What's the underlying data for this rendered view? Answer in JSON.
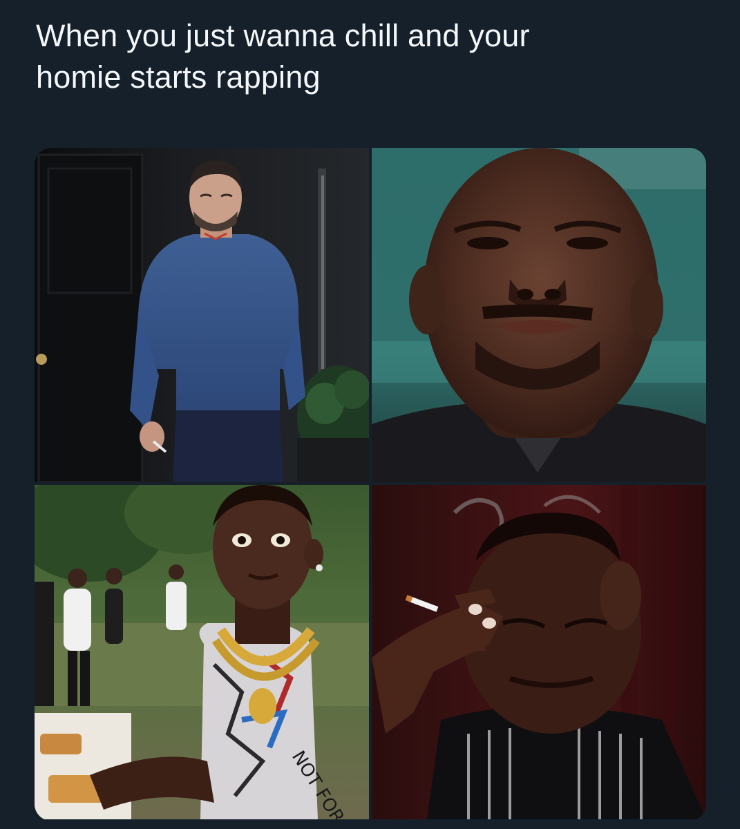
{
  "tweet": {
    "text_line_1": "When you just wanna chill and your",
    "text_line_2": "homie starts rapping"
  },
  "media": {
    "panels": [
      {
        "icon": "man-in-blue-sweater-smoking-photo"
      },
      {
        "icon": "man-looking-up-closeup-photo"
      },
      {
        "icon": "man-with-gold-chain-staring-photo",
        "shirt_text": "NOT FOR SALE"
      },
      {
        "icon": "man-holding-head-with-cigarette-photo"
      }
    ]
  },
  "colors": {
    "background": "#15202b",
    "text": "#f5f8fa"
  }
}
